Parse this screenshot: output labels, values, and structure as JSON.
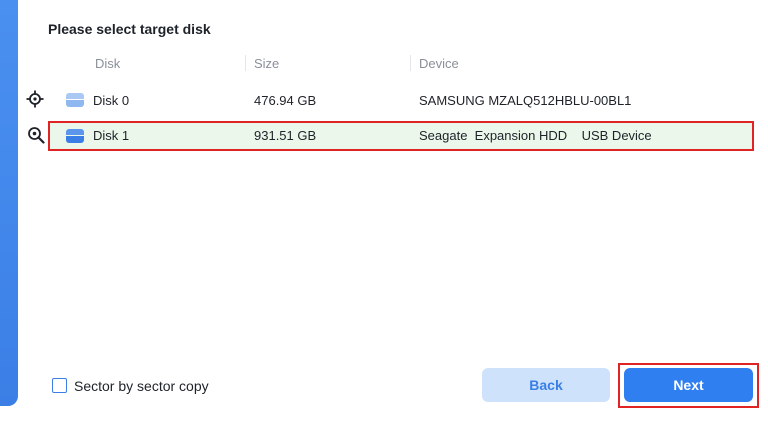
{
  "title": "Please select target disk",
  "columns": {
    "disk": "Disk",
    "size": "Size",
    "device": "Device"
  },
  "disks": [
    {
      "name": "Disk 0",
      "size": "476.94 GB",
      "device": "SAMSUNG MZALQ512HBLU-00BL1",
      "role_icon": "source-crosshair-icon",
      "selected": false
    },
    {
      "name": "Disk 1",
      "size": "931.51 GB",
      "device": "Seagate  Expansion HDD    USB Device",
      "role_icon": "target-search-icon",
      "selected": true
    }
  ],
  "options": {
    "sector_copy_label": "Sector by sector copy",
    "sector_copy_checked": false
  },
  "buttons": {
    "back": "Back",
    "next": "Next"
  },
  "colors": {
    "accent": "#2f7ff0",
    "selected_row_bg": "#eaf7ea",
    "highlight_border": "#e02424",
    "disk0_icon": "#8fb8f0",
    "disk1_icon": "#3b7fe6"
  }
}
